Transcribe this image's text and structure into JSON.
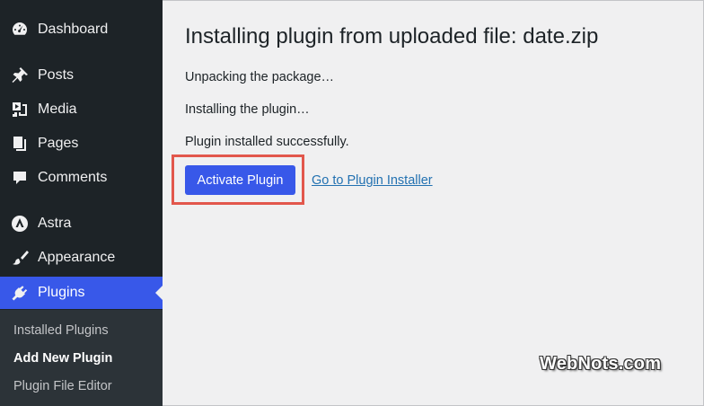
{
  "sidebar": {
    "items": [
      {
        "label": "Dashboard",
        "icon": "dashboard-icon"
      },
      {
        "label": "Posts",
        "icon": "pin-icon"
      },
      {
        "label": "Media",
        "icon": "media-icon"
      },
      {
        "label": "Pages",
        "icon": "pages-icon"
      },
      {
        "label": "Comments",
        "icon": "comment-icon"
      },
      {
        "label": "Astra",
        "icon": "astra-icon"
      },
      {
        "label": "Appearance",
        "icon": "paintbrush-icon"
      },
      {
        "label": "Plugins",
        "icon": "plugin-icon",
        "active": true
      }
    ],
    "submenu": [
      {
        "label": "Installed Plugins"
      },
      {
        "label": "Add New Plugin",
        "current": true
      },
      {
        "label": "Plugin File Editor"
      }
    ]
  },
  "main": {
    "title": "Installing plugin from uploaded file: date.zip",
    "messages": [
      "Unpacking the package…",
      "Installing the plugin…",
      "Plugin installed successfully."
    ],
    "activate_label": "Activate Plugin",
    "installer_link": "Go to Plugin Installer"
  },
  "watermark": "WebNots.com",
  "colors": {
    "sidebar_bg": "#1d2327",
    "accent": "#3858e9",
    "highlight_border": "#e2574c",
    "link": "#2271b1"
  }
}
